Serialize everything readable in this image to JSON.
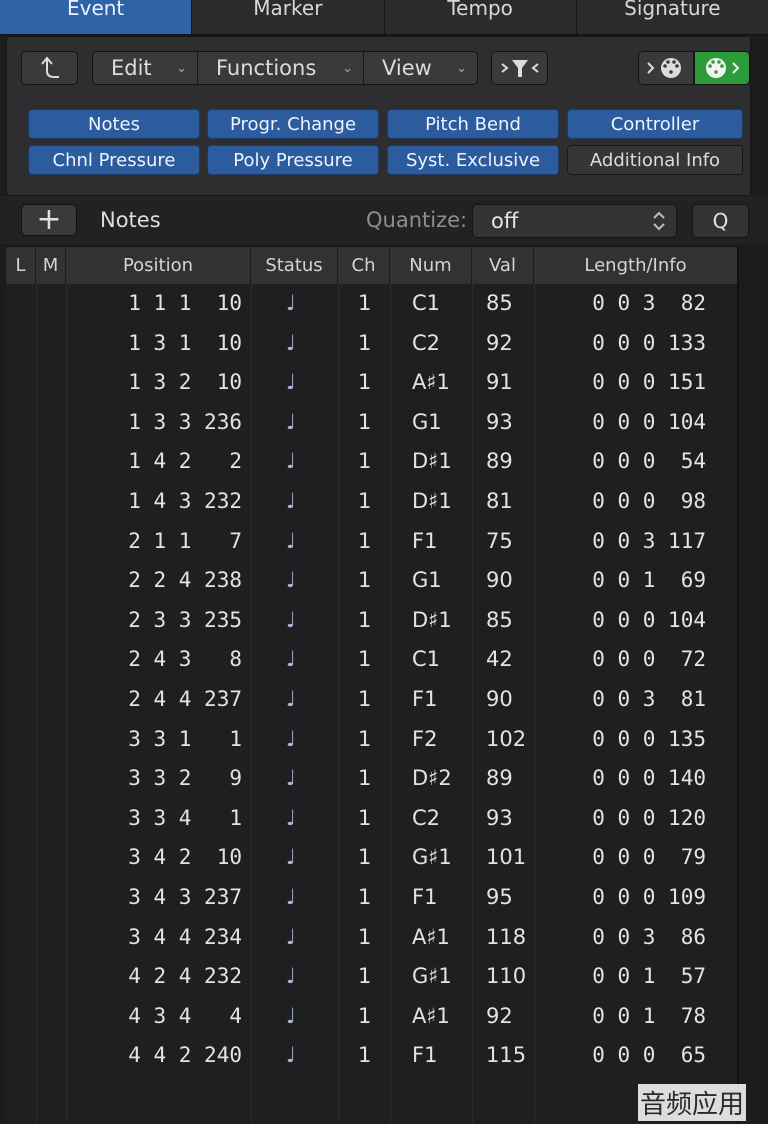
{
  "tabs": [
    {
      "label": "Event",
      "active": true
    },
    {
      "label": "Marker",
      "active": false
    },
    {
      "label": "Tempo",
      "active": false
    },
    {
      "label": "Signature",
      "active": false
    }
  ],
  "toolbar": {
    "up_icon": "up-arrow-icon",
    "menus": [
      {
        "label": "Edit"
      },
      {
        "label": "Functions"
      },
      {
        "label": "View"
      }
    ],
    "filter_icon": "funnel-icon",
    "midi_in_icon": "midi-in-icon",
    "midi_out_icon": "midi-out-icon"
  },
  "filters": [
    {
      "label": "Notes",
      "on": true
    },
    {
      "label": "Progr. Change",
      "on": true
    },
    {
      "label": "Pitch Bend",
      "on": true
    },
    {
      "label": "Controller",
      "on": true
    },
    {
      "label": "Chnl Pressure",
      "on": true
    },
    {
      "label": "Poly Pressure",
      "on": true
    },
    {
      "label": "Syst. Exclusive",
      "on": true
    },
    {
      "label": "Additional Info",
      "on": false
    }
  ],
  "header": {
    "add_label": "+",
    "title": "Notes",
    "quantize_label": "Quantize:",
    "quantize_value": "off",
    "q_button": "Q"
  },
  "columns": [
    "L",
    "M",
    "Position",
    "Status",
    "Ch",
    "Num",
    "Val",
    "Length/Info"
  ],
  "rows": [
    {
      "pos": "1 1 1  10",
      "ch": "1",
      "num": "C1",
      "val": "85",
      "len": "0 0 3  82"
    },
    {
      "pos": "1 3 1  10",
      "ch": "1",
      "num": "C2",
      "val": "92",
      "len": "0 0 0 133"
    },
    {
      "pos": "1 3 2  10",
      "ch": "1",
      "num": "A♯1",
      "val": "91",
      "len": "0 0 0 151"
    },
    {
      "pos": "1 3 3 236",
      "ch": "1",
      "num": "G1",
      "val": "93",
      "len": "0 0 0 104"
    },
    {
      "pos": "1 4 2   2",
      "ch": "1",
      "num": "D♯1",
      "val": "89",
      "len": "0 0 0  54"
    },
    {
      "pos": "1 4 3 232",
      "ch": "1",
      "num": "D♯1",
      "val": "81",
      "len": "0 0 0  98"
    },
    {
      "pos": "2 1 1   7",
      "ch": "1",
      "num": "F1",
      "val": "75",
      "len": "0 0 3 117"
    },
    {
      "pos": "2 2 4 238",
      "ch": "1",
      "num": "G1",
      "val": "90",
      "len": "0 0 1  69"
    },
    {
      "pos": "2 3 3 235",
      "ch": "1",
      "num": "D♯1",
      "val": "85",
      "len": "0 0 0 104"
    },
    {
      "pos": "2 4 3   8",
      "ch": "1",
      "num": "C1",
      "val": "42",
      "len": "0 0 0  72"
    },
    {
      "pos": "2 4 4 237",
      "ch": "1",
      "num": "F1",
      "val": "90",
      "len": "0 0 3  81"
    },
    {
      "pos": "3 3 1   1",
      "ch": "1",
      "num": "F2",
      "val": "102",
      "len": "0 0 0 135"
    },
    {
      "pos": "3 3 2   9",
      "ch": "1",
      "num": "D♯2",
      "val": "89",
      "len": "0 0 0 140"
    },
    {
      "pos": "3 3 4   1",
      "ch": "1",
      "num": "C2",
      "val": "93",
      "len": "0 0 0 120"
    },
    {
      "pos": "3 4 2  10",
      "ch": "1",
      "num": "G♯1",
      "val": "101",
      "len": "0 0 0  79"
    },
    {
      "pos": "3 4 3 237",
      "ch": "1",
      "num": "F1",
      "val": "95",
      "len": "0 0 0 109"
    },
    {
      "pos": "3 4 4 234",
      "ch": "1",
      "num": "A♯1",
      "val": "118",
      "len": "0 0 3  86"
    },
    {
      "pos": "4 2 4 232",
      "ch": "1",
      "num": "G♯1",
      "val": "110",
      "len": "0 0 1  57"
    },
    {
      "pos": "4 3 4   4",
      "ch": "1",
      "num": "A♯1",
      "val": "92",
      "len": "0 0 1  78"
    },
    {
      "pos": "4 4 2 240",
      "ch": "1",
      "num": "F1",
      "val": "115",
      "len": "0 0 0  65"
    }
  ],
  "status_icon": "quarter-note-icon",
  "status_glyph": "♩",
  "watermark": "音频应用",
  "colors": {
    "accent": "#2f63a8",
    "filter_on": "#2c5c9e",
    "midi_out_active": "#2e9b3a"
  }
}
